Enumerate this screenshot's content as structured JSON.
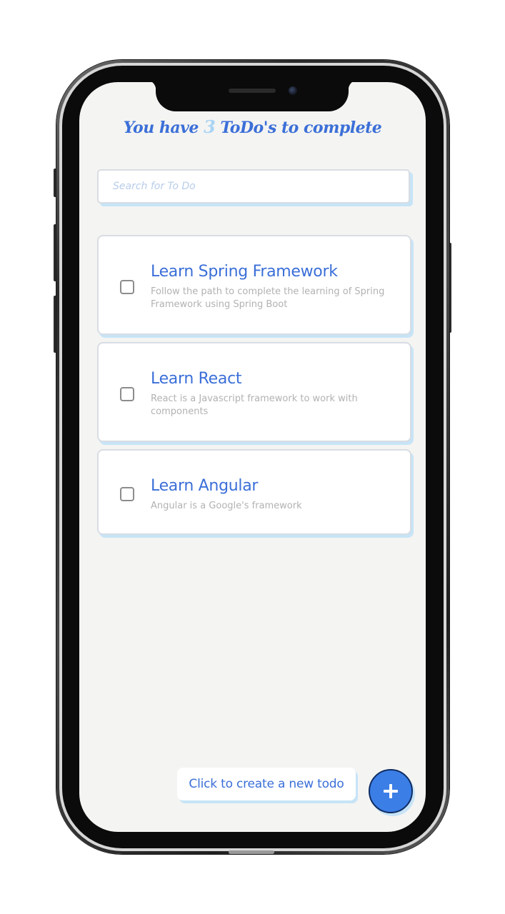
{
  "header": {
    "prefix": "You have",
    "count": "3",
    "suffix": "ToDo's to complete"
  },
  "search": {
    "placeholder": "Search for To Do",
    "value": ""
  },
  "todos": [
    {
      "title": "Learn Spring Framework",
      "description": "Follow the path to complete the learning of Spring Framework using Spring Boot",
      "checked": false
    },
    {
      "title": "Learn React",
      "description": "React is a Javascript framework to work with components",
      "checked": false
    },
    {
      "title": "Learn Angular",
      "description": "Angular is a Google's framework",
      "checked": false
    }
  ],
  "create": {
    "hint_label": "Click to create a new todo",
    "fab_icon": "plus-icon"
  },
  "colors": {
    "accent": "#3b6fd8",
    "fab": "#3b7ee6",
    "count": "#a9d4f5",
    "background": "#f4f4f2",
    "shadow": "#c7e4f7"
  }
}
